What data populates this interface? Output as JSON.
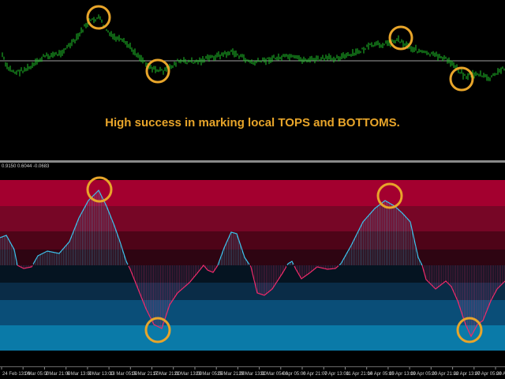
{
  "caption": "High success in marking local TOPS and BOTTOMS.",
  "indicator_values": "0.9150 0.6044 -0.0683",
  "time_axis": {
    "ticks": [
      "24 Feb 13:00",
      "1 Mar 05:00",
      "2 Mar 21:00",
      "6 Mar 13:00",
      "8 Mar 13:00",
      "13 Mar 05:00",
      "15 Mar 21:00",
      "17 Mar 21:00",
      "21 Mar 13:00",
      "23 Mar 05:00",
      "25 Mar 21:00",
      "29 Mar 13:00",
      "31 Mar 05:00",
      "4 Apr 05:00",
      "6 Apr 21:00",
      "7 Apr 13:00",
      "11 Apr 21:00",
      "14 Apr 05:00",
      "15 Apr 13:00",
      "19 Apr 05:00",
      "20 Apr 21:00",
      "22 Apr 13:00",
      "27 Apr 05:00",
      "28 Apr 21:00"
    ]
  },
  "colors": {
    "price_bars": "#21c32a",
    "baseline": "#a0a0a0",
    "marker_circle": "#e8a52a",
    "positive_line": "#3cc3ec",
    "negative_line": "#f02a6a",
    "bands_top": [
      "#a3002f",
      "#770626",
      "#4e0418",
      "#2e0512"
    ],
    "bands_bottom": [
      "#051421",
      "#0a2c47",
      "#0a4e78",
      "#0a7aa8"
    ]
  },
  "markers": [
    "top-1",
    "bottom-1",
    "top-2",
    "bottom-2",
    "indicator-top-1",
    "indicator-bottom-1",
    "indicator-top-2",
    "indicator-bottom-2"
  ]
}
